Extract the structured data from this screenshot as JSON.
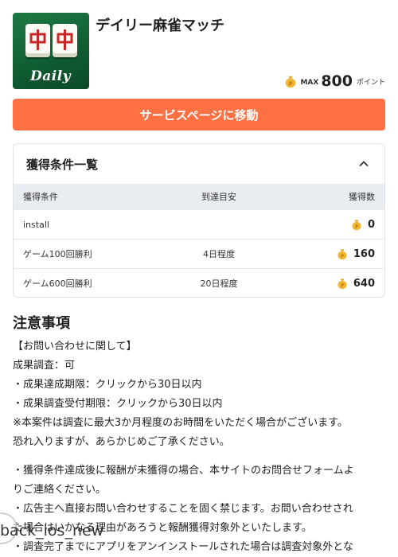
{
  "app": {
    "icon_logo_text": "Daily",
    "title": "デイリー麻雀マッチ",
    "max_label": "MAX",
    "max_points": "800",
    "points_unit": "ポイント"
  },
  "service_button": {
    "label": "サービスページに移動"
  },
  "conditions": {
    "title": "獲得条件一覧",
    "columns": [
      "獲得条件",
      "到達目安",
      "獲得数"
    ],
    "rows": [
      {
        "condition": "install",
        "estimate": "",
        "points": "0"
      },
      {
        "condition": "ゲーム100回勝利",
        "estimate": "4日程度",
        "points": "160"
      },
      {
        "condition": "ゲーム600回勝利",
        "estimate": "20日程度",
        "points": "640"
      }
    ]
  },
  "notes": {
    "title": "注意事項",
    "lines": [
      "【お問い合わせに関して】",
      "成果調査：可",
      "・成果達成期限：クリックから30日以内",
      "・成果調査受付期限：クリックから30日以内",
      "※本案件は調査に最大3か月程度のお時間をいただく場合がございます。",
      "恐れ入りますが、あらかじめご了承ください。",
      "・獲得条件達成後に報酬が未獲得の場合、本サイトのお問合せフォームよ",
      "りご連絡ください。",
      "・広告主へ直接お問い合わせすることを固く禁じます。お問い合わせされ",
      "た場合はいかなる理由があろうと報酬獲得対象外といたします。",
      "・調査完了までにアプリをアンインストールされた場合は調査対象外とな"
    ]
  },
  "overlay": {
    "back_label": "back_ios_new"
  },
  "colors": {
    "accent": "#ff7043",
    "table_header_bg": "#e9edf2",
    "icon_green": "#1f7a45"
  }
}
